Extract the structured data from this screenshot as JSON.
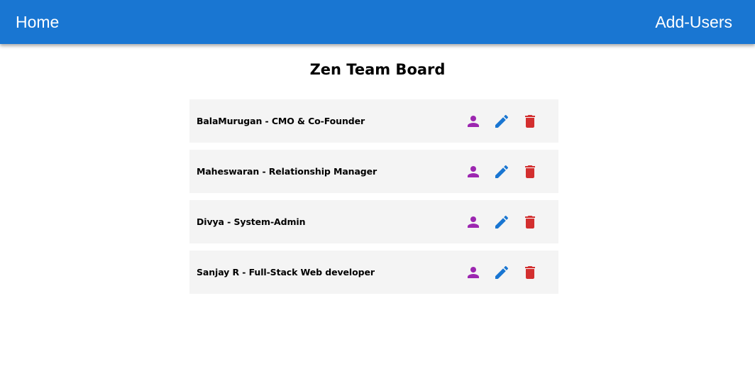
{
  "header": {
    "home_label": "Home",
    "add_users_label": "Add-Users",
    "background_color": "#1976d2"
  },
  "main": {
    "title": "Zen Team Board"
  },
  "users": [
    {
      "name": "BalaMurugan",
      "role": "CMO & Co-Founder"
    },
    {
      "name": "Maheswaran",
      "role": "Relationship Manager"
    },
    {
      "name": "Divya",
      "role": "System-Admin"
    },
    {
      "name": "Sanjay R",
      "role": "Full-Stack Web developer"
    }
  ],
  "row_separator": " - ",
  "icons": {
    "profile": {
      "name": "person-icon",
      "color": "#9c27b0"
    },
    "edit": {
      "name": "edit-icon",
      "color": "#1976d2"
    },
    "delete": {
      "name": "delete-icon",
      "color": "#d32f2f"
    }
  }
}
